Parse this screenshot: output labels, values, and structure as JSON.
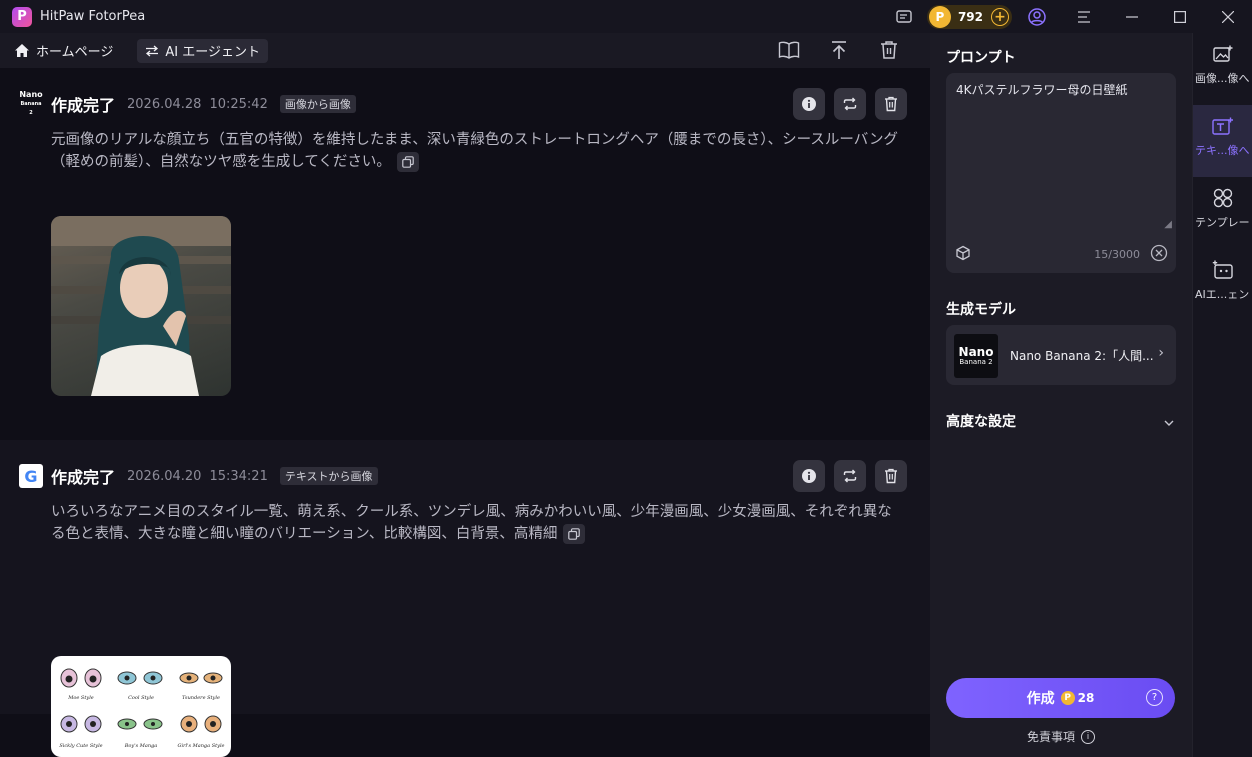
{
  "app": {
    "title": "HitPaw FotorPea",
    "coins": "792"
  },
  "toolbar": {
    "home_label": "ホームページ",
    "agent_label": "AI エージェント"
  },
  "feed": [
    {
      "status": "作成完了",
      "date": "2026.04.28",
      "time": "10:25:42",
      "tag": "画像から画像",
      "prompt": "元画像のリアルな顔立ち（五官の特徴）を維持したまま、深い青緑色のストレートロングヘア（腰までの長さ）、シースルーバング（軽めの前髪）、自然なツヤ感を生成してください。",
      "model_logo": {
        "line1": "Nano",
        "line2": "Banana 2"
      }
    },
    {
      "status": "作成完了",
      "date": "2026.04.20",
      "time": "15:34:21",
      "tag": "テキストから画像",
      "prompt": "いろいろなアニメ目のスタイル一覧、萌え系、クール系、ツンデレ風、病みかわいい風、少年漫画風、少女漫画風、それぞれ異なる色と表情、大きな瞳と細い瞳のバリエーション、比較構図、白背景、高精細",
      "model_logo": {
        "letter": "G"
      },
      "eye_labels": [
        "Moe Style",
        "Cool Style",
        "Tsundere Style",
        "Sickly Cute Style",
        "Boy's Manga",
        "Girl's Manga Style"
      ]
    }
  ],
  "panel": {
    "prompt_title": "プロンプト",
    "prompt_value": "4Kパステルフラワー母の日壁紙",
    "char_count": "15/3000",
    "model_title": "生成モデル",
    "model_name": "Nano Banana 2:「人間...",
    "model_thumb": {
      "line1": "Nano",
      "line2": "Banana 2"
    },
    "advanced_title": "高度な設定",
    "create_label": "作成",
    "create_cost": "28",
    "disclaimer": "免責事項"
  },
  "rail": [
    {
      "label": "画像...像へ",
      "icon": "image-plus-icon"
    },
    {
      "label": "テキ...像へ",
      "icon": "text-image-icon"
    },
    {
      "label": "テンプレート",
      "icon": "template-icon"
    },
    {
      "label": "AIエ...ェント",
      "icon": "ai-agent-icon"
    }
  ]
}
